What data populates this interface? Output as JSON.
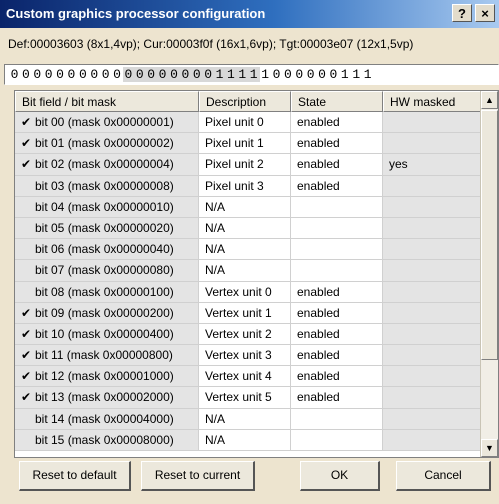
{
  "window": {
    "title": "Custom graphics processor configuration",
    "help_label": "?",
    "close_label": "×"
  },
  "info_line": "Def:00003603 (8x1,4vp); Cur:00003f0f (16x1,6vp); Tgt:00003e07 (12x1,5vp)",
  "bits": [
    "0",
    "0",
    "0",
    "0",
    "0",
    "0",
    "0",
    "0",
    "0",
    "0",
    "0",
    "0",
    "0",
    "0",
    "0",
    "0",
    "0",
    "0",
    "1",
    "1",
    "1",
    "1",
    "1",
    "0",
    "0",
    "0",
    "0",
    "0",
    "0",
    "1",
    "1",
    "1"
  ],
  "table": {
    "columns": [
      "Bit field / bit mask",
      "Description",
      "State",
      "HW masked"
    ],
    "rows": [
      {
        "checked": true,
        "label": "bit 00 (mask 0x00000001)",
        "description": "Pixel unit 0",
        "state": "enabled",
        "hw": ""
      },
      {
        "checked": true,
        "label": "bit 01 (mask 0x00000002)",
        "description": "Pixel unit 1",
        "state": "enabled",
        "hw": ""
      },
      {
        "checked": true,
        "label": "bit 02 (mask 0x00000004)",
        "description": "Pixel unit 2",
        "state": "enabled",
        "hw": "yes"
      },
      {
        "checked": false,
        "label": "bit 03 (mask 0x00000008)",
        "description": "Pixel unit 3",
        "state": "enabled",
        "hw": ""
      },
      {
        "checked": false,
        "label": "bit 04 (mask 0x00000010)",
        "description": "N/A",
        "state": "",
        "hw": ""
      },
      {
        "checked": false,
        "label": "bit 05 (mask 0x00000020)",
        "description": "N/A",
        "state": "",
        "hw": ""
      },
      {
        "checked": false,
        "label": "bit 06 (mask 0x00000040)",
        "description": "N/A",
        "state": "",
        "hw": ""
      },
      {
        "checked": false,
        "label": "bit 07 (mask 0x00000080)",
        "description": "N/A",
        "state": "",
        "hw": ""
      },
      {
        "checked": false,
        "label": "bit 08 (mask 0x00000100)",
        "description": "Vertex unit 0",
        "state": "enabled",
        "hw": ""
      },
      {
        "checked": true,
        "label": "bit 09 (mask 0x00000200)",
        "description": "Vertex unit 1",
        "state": "enabled",
        "hw": ""
      },
      {
        "checked": true,
        "label": "bit 10 (mask 0x00000400)",
        "description": "Vertex unit 2",
        "state": "enabled",
        "hw": ""
      },
      {
        "checked": true,
        "label": "bit 11 (mask 0x00000800)",
        "description": "Vertex unit 3",
        "state": "enabled",
        "hw": ""
      },
      {
        "checked": true,
        "label": "bit 12 (mask 0x00001000)",
        "description": "Vertex unit 4",
        "state": "enabled",
        "hw": ""
      },
      {
        "checked": true,
        "label": "bit 13 (mask 0x00002000)",
        "description": "Vertex unit 5",
        "state": "enabled",
        "hw": ""
      },
      {
        "checked": false,
        "label": "bit 14 (mask 0x00004000)",
        "description": "N/A",
        "state": "",
        "hw": ""
      },
      {
        "checked": false,
        "label": "bit 15 (mask 0x00008000)",
        "description": "N/A",
        "state": "",
        "hw": ""
      }
    ]
  },
  "scrollbar": {
    "up_icon": "▲",
    "down_icon": "▼"
  },
  "buttons": {
    "reset_default": "Reset to default",
    "reset_current": "Reset to current",
    "ok": "OK",
    "cancel": "Cancel"
  }
}
